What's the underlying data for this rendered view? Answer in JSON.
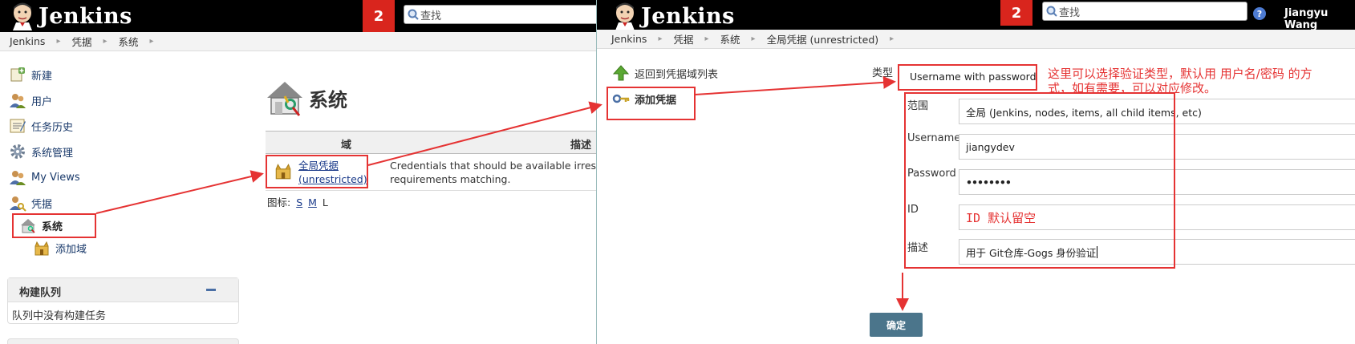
{
  "left": {
    "logo_text": "Jenkins",
    "badge_count": "2",
    "search_placeholder": "查找",
    "breadcrumb": [
      "Jenkins",
      "凭据",
      "系统"
    ],
    "sidebar": [
      {
        "label": "新建",
        "icon": "new-item-icon"
      },
      {
        "label": "用户",
        "icon": "users-icon"
      },
      {
        "label": "任务历史",
        "icon": "build-history-icon"
      },
      {
        "label": "系统管理",
        "icon": "gear-icon"
      },
      {
        "label": "My Views",
        "icon": "users-icon"
      },
      {
        "label": "凭据",
        "icon": "credentials-icon"
      },
      {
        "label": "系统",
        "icon": "system-store-icon"
      },
      {
        "label": "添加域",
        "icon": "domain-icon"
      }
    ],
    "build_queue": {
      "title": "构建队列",
      "empty_text": "队列中没有构建任务"
    },
    "page_title": "系统",
    "table": {
      "col_domain": "域",
      "col_desc": "描述",
      "row_link_line1": "全局凭据",
      "row_link_line2": "(unrestricted)",
      "row_desc_line1": "Credentials that should be available irrespe",
      "row_desc_line2": "requirements matching."
    },
    "icon_size": {
      "label": "图标:",
      "options": [
        "S",
        "M",
        "L"
      ]
    }
  },
  "right": {
    "logo_text": "Jenkins",
    "badge_count": "2",
    "search_placeholder": "查找",
    "help_glyph": "?",
    "user_name": "Jiangyu Wang",
    "breadcrumb": [
      "Jenkins",
      "凭据",
      "系统",
      "全局凭据 (unrestricted)"
    ],
    "sidebar": [
      {
        "label": "返回到凭据域列表",
        "icon": "up-arrow-icon"
      },
      {
        "label": "添加凭据",
        "icon": "key-icon"
      }
    ],
    "form": {
      "kind_label": "类型",
      "kind_value": "Username with password",
      "scope_label": "范围",
      "scope_value": "全局 (Jenkins, nodes, items, all child items, etc)",
      "username_label": "Username",
      "username_value": "jiangydev",
      "password_label": "Password",
      "password_value": "••••••••",
      "id_label": "ID",
      "id_annotation": "ID 默认留空",
      "desc_label": "描述",
      "desc_value": "用于 Git仓库-Gogs 身份验证",
      "ok_button": "确定"
    },
    "annotation": {
      "line1": "这里可以选择验证类型，默认用 用户名/密码 的方",
      "line2": "式，如有需要，可以对应修改。"
    }
  },
  "colors": {
    "annotation": "#e53333",
    "jenkins_red": "#d9251d",
    "button": "#4b758b",
    "link": "#1a3a8a"
  }
}
